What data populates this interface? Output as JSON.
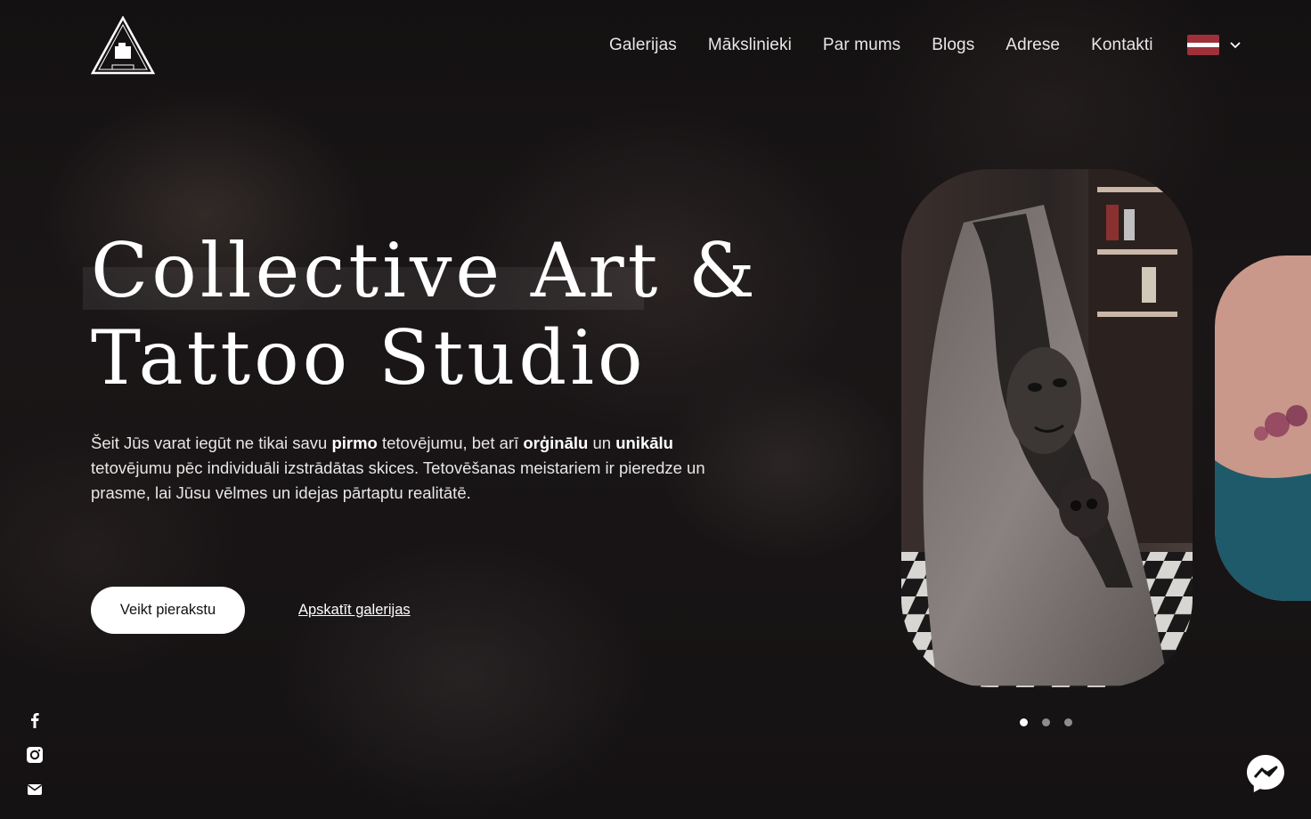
{
  "nav": {
    "items": [
      {
        "label": "Galerijas"
      },
      {
        "label": "Mākslinieki"
      },
      {
        "label": "Par mums"
      },
      {
        "label": "Blogs"
      },
      {
        "label": "Adrese"
      },
      {
        "label": "Kontakti"
      }
    ],
    "language_flag_colors": [
      "#9e3039",
      "#ffffff",
      "#9e3039"
    ],
    "language_icon": "chevron-down-icon"
  },
  "hero": {
    "title_line1": "Collective Art &",
    "title_line2": "Tattoo Studio",
    "text_1": "Šeit Jūs varat iegūt ne tikai savu ",
    "text_bold_1": "pirmo",
    "text_2": " tetovējumu, bet arī ",
    "text_bold_2": "orģinālu",
    "text_3": " un ",
    "text_bold_3": "unikālu",
    "text_4": " tetovējumu pēc individuāli izstrādātas skices. Tetovēšanas meistariem ir pieredze un prasme, lai Jūsu vēlmes un idejas pārtaptu realitātē.",
    "primary_button": "Veikt pierakstu",
    "secondary_link": "Apskatīt galerijas"
  },
  "social": [
    "facebook-icon",
    "instagram-icon",
    "email-icon"
  ],
  "carousel": {
    "slides": 3,
    "active_index": 0
  },
  "chat_widget_icon": "messenger-icon",
  "colors": {
    "background": "#141112",
    "text": "#ffffff",
    "button_bg": "#ffffff",
    "button_text": "#111111",
    "flag_red": "#9e3039"
  }
}
